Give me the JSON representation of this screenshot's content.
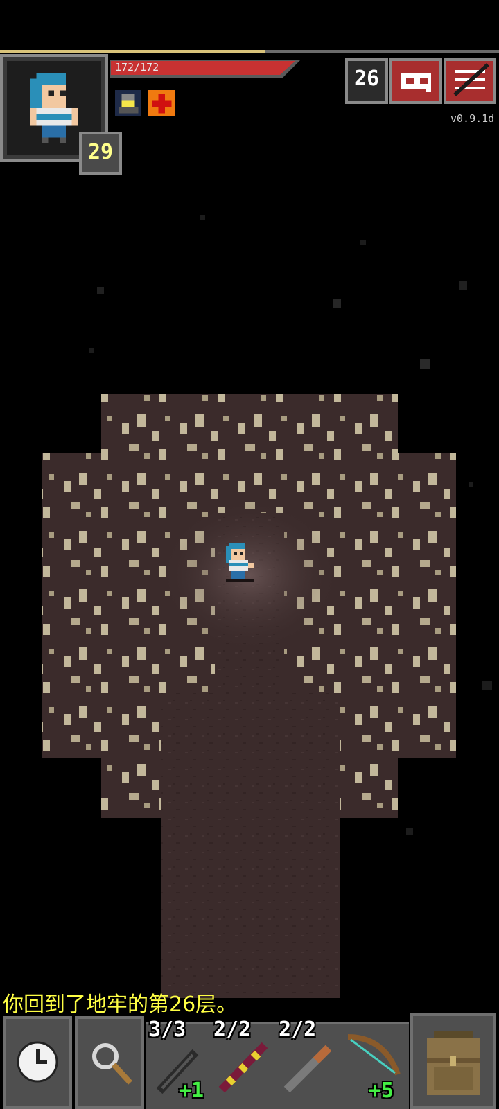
{
  "hero": {
    "hp_text": "172/172",
    "hp_fraction": 1.0,
    "xp_fraction": 0.53,
    "level": "29"
  },
  "buffs": [
    {
      "icon": "light-buff-icon"
    },
    {
      "icon": "healing-buff-icon"
    }
  ],
  "depth": "26",
  "journal_icon": "journal-icon",
  "menu_icon": "menu-icon",
  "version": "v0.9.1d",
  "message": "你回到了地牢的第26层。",
  "toolbar": {
    "wait_icon": "clock-icon",
    "search_icon": "magnifier-icon",
    "quickslots": [
      {
        "icon": "dark-wand-icon",
        "charges": "3/3",
        "level": "+1"
      },
      {
        "icon": "striped-wand-icon",
        "charges": "2/2",
        "level": ""
      },
      {
        "icon": "wooden-wand-icon",
        "charges": "2/2",
        "level": ""
      },
      {
        "icon": "bow-icon",
        "charges": "",
        "level": "+5"
      }
    ],
    "backpack_icon": "backpack-icon"
  },
  "colors": {
    "hp": "#c83232",
    "floor": "#3b2b2b",
    "rock": "#c2b79a",
    "message": "#ffff44",
    "button_red": "#a82e2e"
  }
}
